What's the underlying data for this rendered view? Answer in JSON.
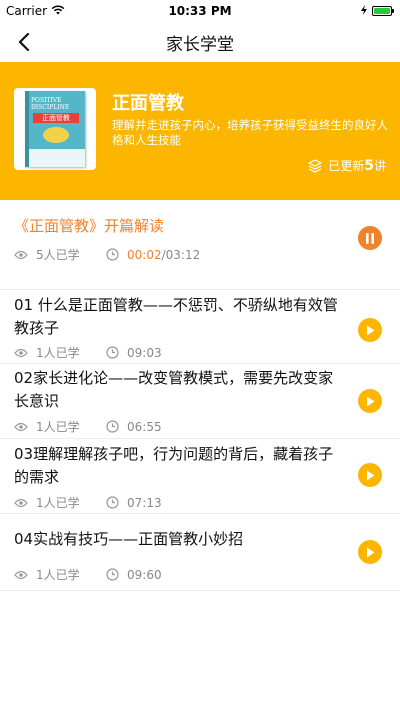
{
  "status_bar": {
    "carrier": "Carrier",
    "time": "10:33 PM"
  },
  "nav": {
    "title": "家长学堂"
  },
  "course": {
    "title": "正面管教",
    "description": "理解并走进孩子内心，培养孩子获得受益终生的良好人格和人生技能",
    "updated_prefix": "已更新",
    "updated_count": "5",
    "updated_suffix": "讲",
    "cover_en": "POSITIVE DISCIPLINE",
    "cover_cn": "正面管教"
  },
  "episodes": [
    {
      "title": "《正面管教》开篇解读",
      "views": "5人已学",
      "elapsed": "00:02",
      "duration": "/03:12",
      "state": "playing"
    },
    {
      "title": "01 什么是正面管教——不惩罚、不骄纵地有效管教孩子",
      "views": "1人已学",
      "duration": "09:03",
      "state": "paused"
    },
    {
      "title": "02家长进化论——改变管教模式，需要先改变家长意识",
      "views": "1人已学",
      "duration": "06:55",
      "state": "paused"
    },
    {
      "title": "03理解理解孩子吧，行为问题的背后，藏着孩子的需求",
      "views": "1人已学",
      "duration": "07:13",
      "state": "paused"
    },
    {
      "title": "04实战有技巧——正面管教小妙招",
      "views": "1人已学",
      "duration": "09:60",
      "state": "paused"
    }
  ],
  "colors": {
    "accent": "#fdb600",
    "active": "#f0822c"
  }
}
